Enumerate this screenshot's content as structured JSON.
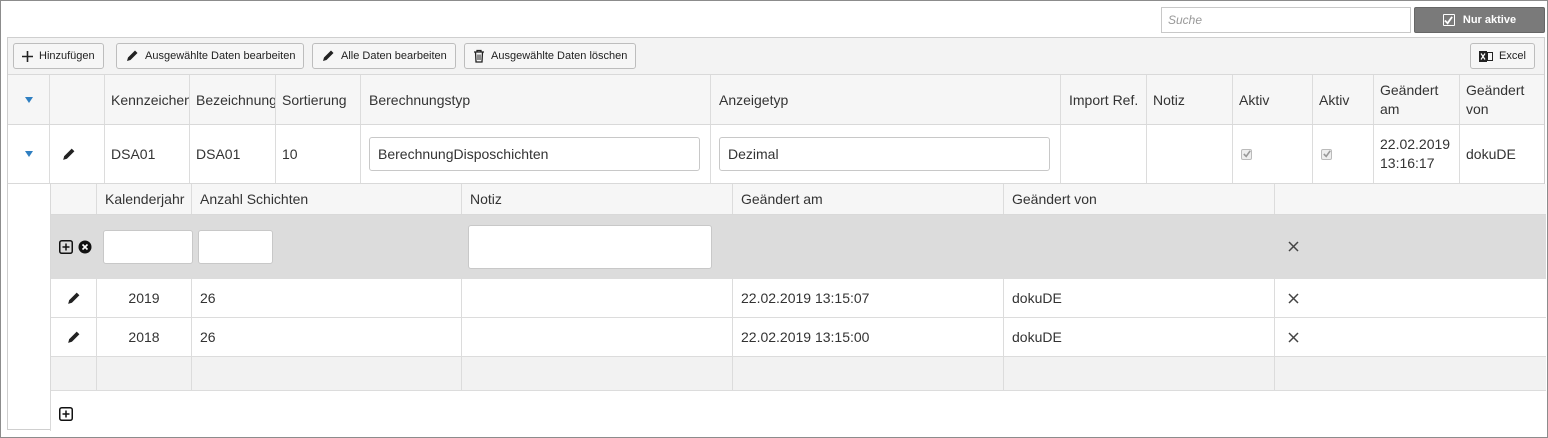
{
  "search": {
    "placeholder": "Suche"
  },
  "only_active_label": "Nur aktive",
  "toolbar": {
    "add_label": "Hinzufügen",
    "edit_selected_label": "Ausgewählte Daten bearbeiten",
    "edit_all_label": "Alle Daten bearbeiten",
    "delete_selected_label": "Ausgewählte Daten löschen",
    "excel_label": "Excel"
  },
  "master": {
    "columns": [
      "Kennzeichen",
      "Bezeichnung",
      "Sortierung",
      "Berechnungstyp",
      "Anzeigetyp",
      "Import Ref.",
      "Notiz",
      "Aktiv",
      "Aktiv",
      "Geändert am",
      "Geändert von"
    ],
    "row": {
      "kennzeichen": "DSA01",
      "bezeichnung": "DSA01",
      "sortierung": "10",
      "berechnungstyp": "BerechnungDisposchichten",
      "anzeigetyp": "Dezimal",
      "import_ref": "",
      "notiz": "",
      "aktiv1": true,
      "aktiv2": true,
      "geaendert_am": "22.02.2019 13:16:17",
      "geaendert_von": "dokuDE"
    }
  },
  "detail": {
    "columns": [
      "Kalenderjahr",
      "Anzahl Schichten",
      "Notiz",
      "Geändert am",
      "Geändert von"
    ],
    "rows": [
      {
        "kalenderjahr": "2019",
        "anzahl": "26",
        "notiz": "",
        "geaendert_am": "22.02.2019 13:15:07",
        "geaendert_von": "dokuDE"
      },
      {
        "kalenderjahr": "2018",
        "anzahl": "26",
        "notiz": "",
        "geaendert_am": "22.02.2019 13:15:00",
        "geaendert_von": "dokuDE"
      }
    ]
  },
  "colors": {
    "accent_arrow": "#2f7fc1",
    "button_dark": "#7a7a7a",
    "new_row_bg": "#dcdcdc"
  },
  "icons": [
    "plus-icon",
    "pencil-icon",
    "trash-icon",
    "excel-icon",
    "checkbox-icon",
    "expand-arrow-icon",
    "plus-square-icon",
    "cancel-circle-icon",
    "delete-x-icon"
  ]
}
